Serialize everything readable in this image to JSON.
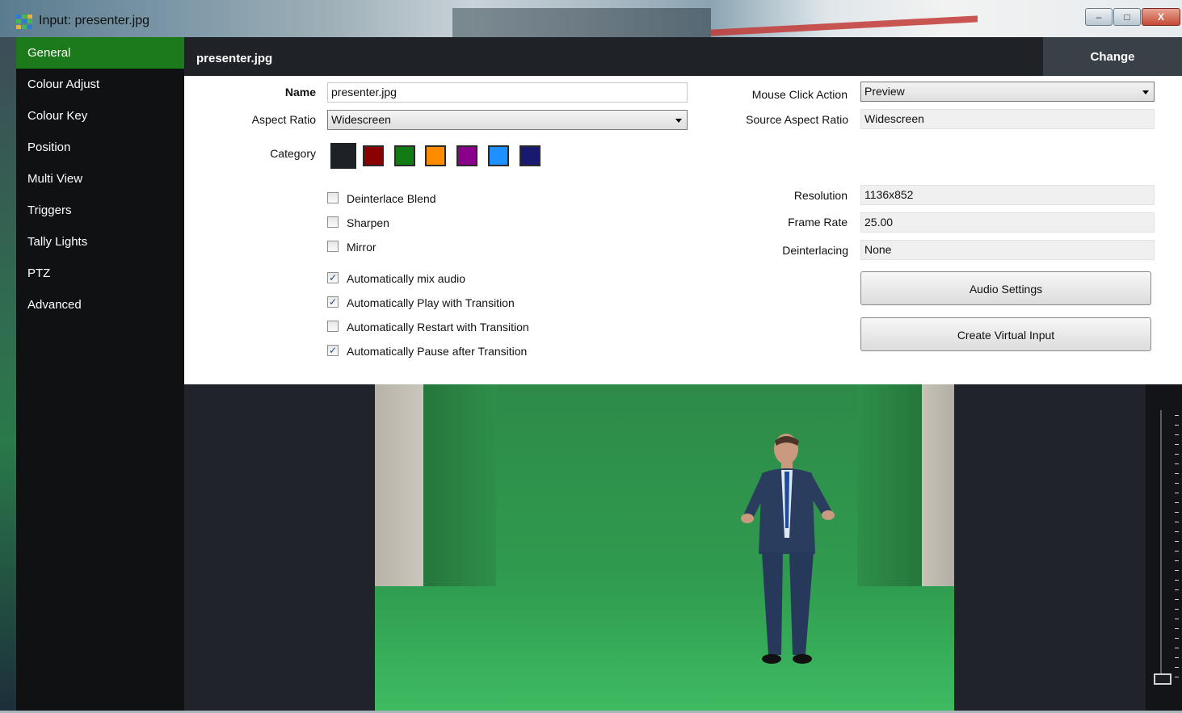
{
  "window": {
    "title": "Input: presenter.jpg",
    "controls": {
      "minimize": "–",
      "maximize": "□",
      "close": "X"
    }
  },
  "sidebar": {
    "items": [
      {
        "label": "General",
        "active": true
      },
      {
        "label": "Colour Adjust"
      },
      {
        "label": "Colour Key"
      },
      {
        "label": "Position"
      },
      {
        "label": "Multi View"
      },
      {
        "label": "Triggers"
      },
      {
        "label": "Tally Lights"
      },
      {
        "label": "PTZ"
      },
      {
        "label": "Advanced"
      }
    ]
  },
  "header": {
    "title": "presenter.jpg",
    "change_label": "Change"
  },
  "form": {
    "name_label": "Name",
    "name_value": "presenter.jpg",
    "aspect_label": "Aspect Ratio",
    "aspect_value": "Widescreen",
    "category_label": "Category",
    "category_colors": [
      "#1e2226",
      "#8b0000",
      "#137b13",
      "#ff8c00",
      "#8b008b",
      "#1e90ff",
      "#191970"
    ],
    "checkboxes": [
      {
        "label": "Deinterlace Blend",
        "checked": false
      },
      {
        "label": "Sharpen",
        "checked": false
      },
      {
        "label": "Mirror",
        "checked": false
      },
      {
        "label": "Automatically mix audio",
        "checked": true
      },
      {
        "label": "Automatically Play with Transition",
        "checked": true
      },
      {
        "label": "Automatically Restart with Transition",
        "checked": false
      },
      {
        "label": "Automatically Pause after Transition",
        "checked": true
      }
    ],
    "mouse_click_label": "Mouse Click Action",
    "mouse_click_value": "Preview",
    "source_aspect_label": "Source Aspect Ratio",
    "source_aspect_value": "Widescreen",
    "resolution_label": "Resolution",
    "resolution_value": "1136x852",
    "frame_rate_label": "Frame Rate",
    "frame_rate_value": "25.00",
    "deinterlacing_label": "Deinterlacing",
    "deinterlacing_value": "None",
    "audio_settings_label": "Audio Settings",
    "create_virtual_label": "Create Virtual Input"
  },
  "preview": {
    "volume_level": 0
  },
  "colors": {
    "accent": "#1c7a1b",
    "panel": "#1f2328",
    "sidebar": "#0f1113"
  }
}
